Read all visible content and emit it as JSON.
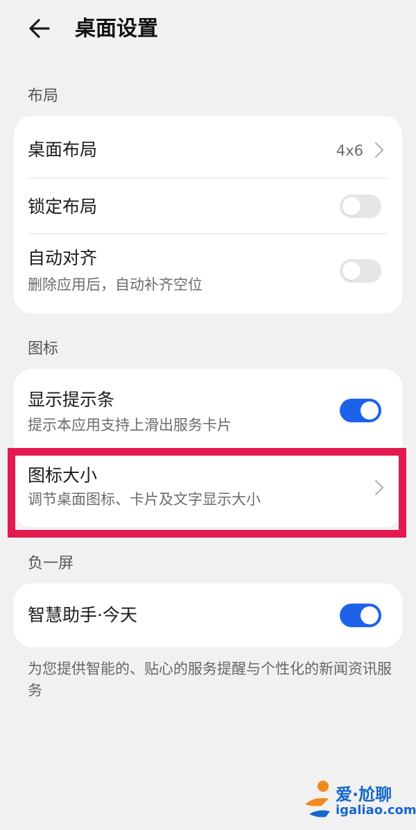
{
  "header": {
    "title": "桌面设置"
  },
  "sections": {
    "layout": {
      "label": "布局",
      "desktop_layout": {
        "title": "桌面布局",
        "value": "4x6"
      },
      "lock_layout": {
        "title": "锁定布局",
        "enabled": false
      },
      "auto_align": {
        "title": "自动对齐",
        "subtitle": "删除应用后，自动补齐空位",
        "enabled": false
      }
    },
    "icons": {
      "label": "图标",
      "show_hint_bar": {
        "title": "显示提示条",
        "subtitle": "提示本应用支持上滑出服务卡片",
        "enabled": true
      },
      "icon_size": {
        "title": "图标大小",
        "subtitle": "调节桌面图标、卡片及文字显示大小"
      }
    },
    "minus_one": {
      "label": "负一屏",
      "smart_assistant": {
        "title": "智慧助手·今天",
        "enabled": true
      },
      "note": "为您提供智能的、贴心的服务提醒与个性化的新闻资讯服务"
    }
  },
  "watermark": {
    "text": "爱·尬聊",
    "url": "igaliao.com"
  },
  "colors": {
    "accent": "#1d62e8",
    "highlight": "#e3194f",
    "background": "#f1f1f1"
  }
}
